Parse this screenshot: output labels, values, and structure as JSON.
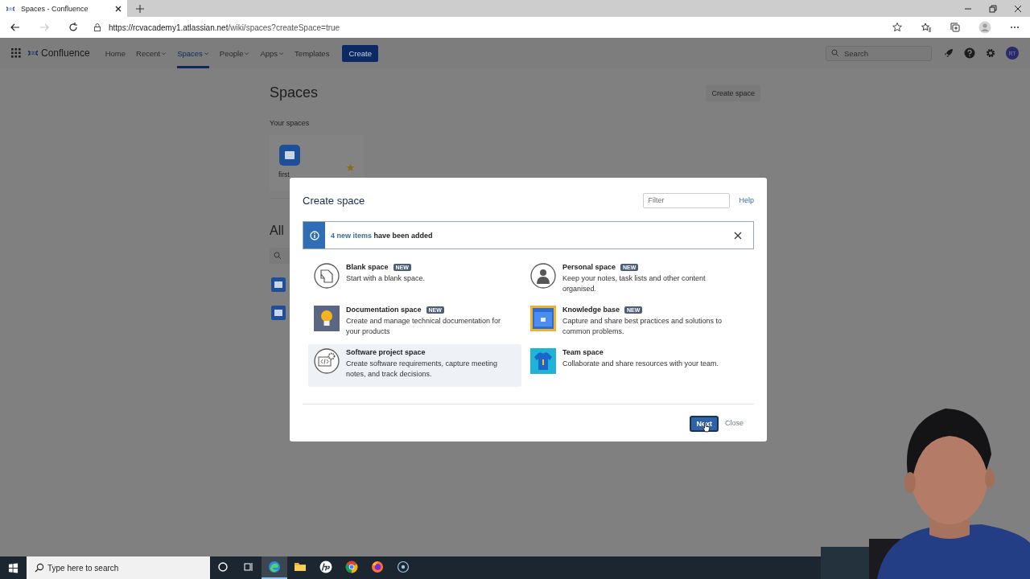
{
  "browser": {
    "tab_title": "Spaces - Confluence",
    "url_host": "https://rcvacademy1.atlassian.net",
    "url_path": "/wiki/spaces?createSpace=true"
  },
  "nav": {
    "product": "Confluence",
    "items": [
      {
        "label": "Home",
        "dropdown": false,
        "selected": false
      },
      {
        "label": "Recent",
        "dropdown": true,
        "selected": false
      },
      {
        "label": "Spaces",
        "dropdown": true,
        "selected": true
      },
      {
        "label": "People",
        "dropdown": true,
        "selected": false
      },
      {
        "label": "Apps",
        "dropdown": true,
        "selected": false
      },
      {
        "label": "Templates",
        "dropdown": false,
        "selected": false
      }
    ],
    "create_button": "Create",
    "search_placeholder": "Search",
    "avatar": "RT"
  },
  "page": {
    "title": "Spaces",
    "create_space_button": "Create space",
    "your_spaces_heading": "Your spaces",
    "space_name": "first",
    "all_spaces_heading": "All"
  },
  "dialog": {
    "title": "Create space",
    "filter_placeholder": "Filter",
    "help_link": "Help",
    "notice": {
      "link": "4 new items",
      "text": "have been added"
    },
    "templates": [
      {
        "kind": "blank",
        "name": "Blank space",
        "badge": "NEW",
        "description": "Start with a blank space.",
        "selected": false
      },
      {
        "kind": "personal",
        "name": "Personal space",
        "badge": "NEW",
        "description": "Keep your notes, task lists and other content organised.",
        "selected": false
      },
      {
        "kind": "documentation",
        "name": "Documentation space",
        "badge": "NEW",
        "description": "Create and manage technical documentation for your products",
        "selected": false
      },
      {
        "kind": "knowledge",
        "name": "Knowledge base",
        "badge": "NEW",
        "description": "Capture and share best practices and solutions to common problems.",
        "selected": false
      },
      {
        "kind": "software",
        "name": "Software project space",
        "description": "Create software requirements, capture meeting notes, and track decisions.",
        "selected": true
      },
      {
        "kind": "team",
        "name": "Team space",
        "description": "Collaborate and share resources with your team.",
        "selected": false
      }
    ],
    "next_button": "Next",
    "close_button": "Close"
  },
  "taskbar": {
    "search_placeholder": "Type here to search",
    "apps": [
      {
        "kind": "cortana",
        "selected": false
      },
      {
        "kind": "taskview",
        "selected": false
      },
      {
        "kind": "edge",
        "selected": true
      },
      {
        "kind": "files",
        "selected": false
      },
      {
        "kind": "hp",
        "selected": false
      },
      {
        "kind": "chrome",
        "selected": false
      },
      {
        "kind": "firefox",
        "selected": false
      },
      {
        "kind": "recorder",
        "selected": false
      }
    ]
  }
}
